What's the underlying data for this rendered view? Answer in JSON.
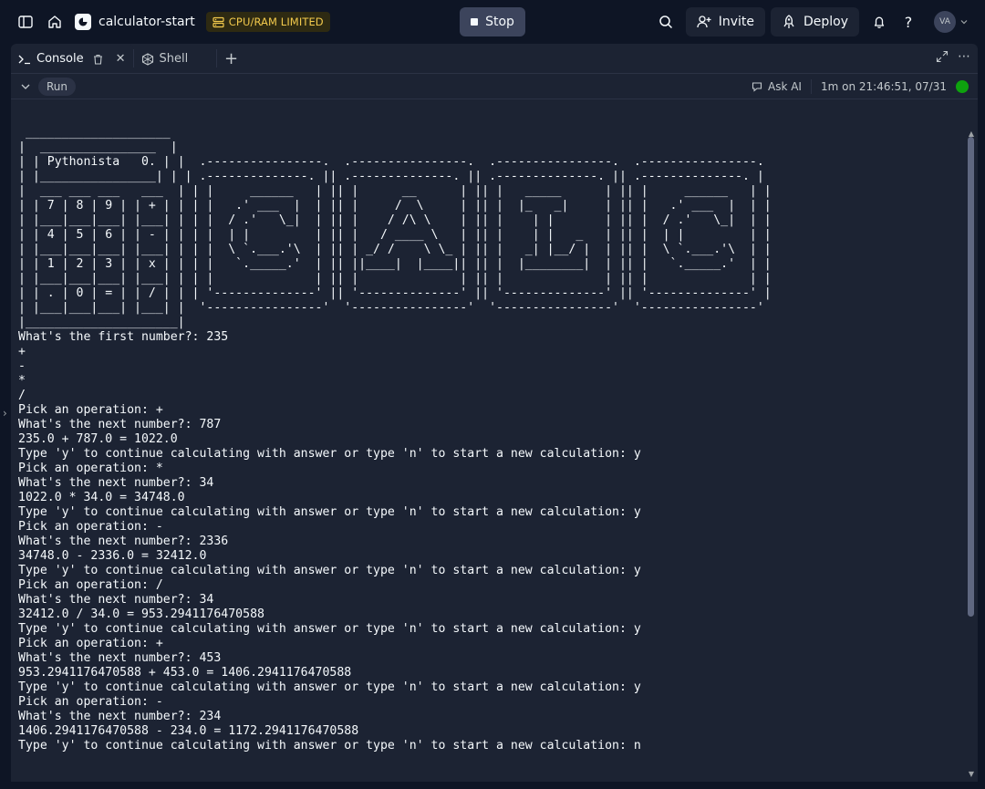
{
  "app": {
    "name": "calculator-start",
    "resource_badge": "CPU/RAM LIMITED",
    "stop_label": "Stop",
    "invite_label": "Invite",
    "deploy_label": "Deploy",
    "avatar_initials": "VA"
  },
  "tabs": [
    {
      "label": "Console",
      "active": true
    },
    {
      "label": "Shell",
      "active": false
    }
  ],
  "toolbar": {
    "run_label": "Run",
    "ask_ai_label": "Ask AI",
    "run_status": "1m on 21:46:51, 07/31"
  },
  "colors": {
    "background": "#0e1525",
    "panel": "#1c2333",
    "status_ok": "#0ea20e",
    "badge_text": "#f2c94c"
  },
  "console": {
    "banner": [
      " ____________________",
      "|  ________________  |",
      "| | Pythonista   0. | |  .----------------.  .----------------.  .----------------.  .----------------.",
      "| |________________| | | .--------------. || .--------------. || .--------------. || .--------------. |",
      "|  ___ ___ ___   ___  | | |     ______   | || |      __      | || |   _____      | || |     ______   | |",
      "| | 7 | 8 | 9 | | + | | | |   .' ___  |  | || |     /  \\     | || |  |_   _|     | || |   .' ___  |  | |",
      "| |___|___|___| |___| | | |  / .'   \\_|  | || |    / /\\ \\    | || |    | |       | || |  / .'   \\_|  | |",
      "| | 4 | 5 | 6 | | - | | | |  | |         | || |   / ____ \\   | || |    | |   _   | || |  | |         | |",
      "| |___|___|___| |___| | | |  \\ `.___.'\\  | || | _/ /    \\ \\_ | || |   _| |__/ |  | || |  \\ `.___.'\\  | |",
      "| | 1 | 2 | 3 | | x | | | |   `._____.'  | || ||____|  |____|| || |  |________|  | || |   `._____.'  | |",
      "| |___|___|___| |___| | | |              | || |              | || |              | || |              | |",
      "| | . | 0 | = | | / | | | '--------------' || '--------------' || '--------------' || '--------------' |",
      "| |___|___|___| |___| |  '----------------'  '----------------'  '----------------'  '----------------'",
      "|_____________________|"
    ],
    "lines": [
      "What's the first number?: 235",
      "+",
      "-",
      "*",
      "/",
      "Pick an operation: +",
      "What's the next number?: 787",
      "235.0 + 787.0 = 1022.0",
      "Type 'y' to continue calculating with answer or type 'n' to start a new calculation: y",
      "Pick an operation: *",
      "What's the next number?: 34",
      "1022.0 * 34.0 = 34748.0",
      "Type 'y' to continue calculating with answer or type 'n' to start a new calculation: y",
      "Pick an operation: -",
      "What's the next number?: 2336",
      "34748.0 - 2336.0 = 32412.0",
      "Type 'y' to continue calculating with answer or type 'n' to start a new calculation: y",
      "Pick an operation: /",
      "What's the next number?: 34",
      "32412.0 / 34.0 = 953.2941176470588",
      "Type 'y' to continue calculating with answer or type 'n' to start a new calculation: y",
      "Pick an operation: +",
      "What's the next number?: 453",
      "953.2941176470588 + 453.0 = 1406.2941176470588",
      "Type 'y' to continue calculating with answer or type 'n' to start a new calculation: y",
      "Pick an operation: -",
      "What's the next number?: 234",
      "1406.2941176470588 - 234.0 = 1172.2941176470588",
      "Type 'y' to continue calculating with answer or type 'n' to start a new calculation: n"
    ]
  }
}
